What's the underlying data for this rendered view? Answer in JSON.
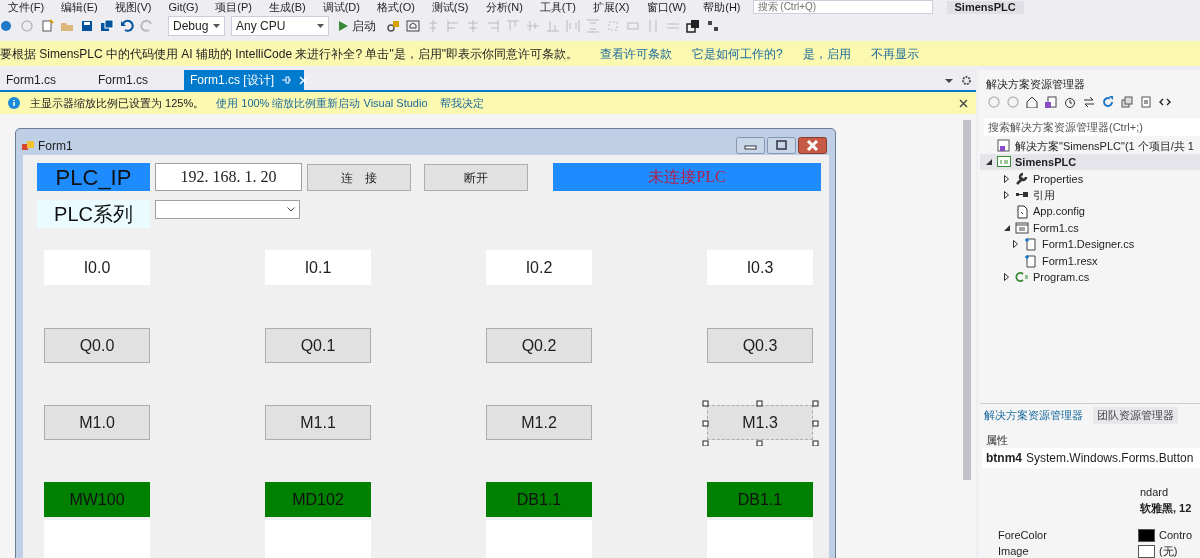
{
  "menu": [
    "文件(F)",
    "编辑(E)",
    "视图(V)",
    "Git(G)",
    "项目(P)",
    "生成(B)",
    "调试(D)",
    "格式(O)",
    "测试(S)",
    "分析(N)",
    "工具(T)",
    "扩展(X)",
    "窗口(W)",
    "帮助(H)"
  ],
  "search": {
    "placeholder": "搜索 (Ctrl+Q)"
  },
  "solution_name": "SimensPLC",
  "toolbar": {
    "configuration": "Debug",
    "platform": "Any CPU",
    "start": "启动"
  },
  "intellicode_bar": {
    "message": "要根据 SimensPLC 中的代码使用 AI 辅助的 IntelliCode 来进行补全? 单击\"是，启用\"即表示你同意许可条款。",
    "links": [
      "查看许可条款",
      "它是如何工作的?",
      "是，启用",
      "不再显示"
    ]
  },
  "tabs": [
    {
      "label": "Form1.cs",
      "selected": false
    },
    {
      "label": "Form1.cs",
      "selected": false
    },
    {
      "label": "Form1.cs [设计]",
      "selected": true
    }
  ],
  "info_bar": {
    "message": "主显示器缩放比例已设置为 125%。",
    "links": [
      "使用 100% 缩放比例重新启动 Visual Studio",
      "帮我决定"
    ]
  },
  "form": {
    "title": "Form1",
    "ip_label": "PLC_IP",
    "ip_value": "192. 168. 1. 20",
    "connect": "连　接",
    "disconnect": "断开",
    "status": "未连接PLC",
    "series_label": "PLC系列",
    "grid": [
      [
        {
          "kind": "label",
          "text": "I0.0",
          "selected": false
        },
        {
          "kind": "label",
          "text": "I0.1",
          "selected": false
        },
        {
          "kind": "label",
          "text": "I0.2",
          "selected": false
        },
        {
          "kind": "label",
          "text": "I0.3",
          "selected": false
        }
      ],
      [
        {
          "kind": "button",
          "text": "Q0.0",
          "selected": false
        },
        {
          "kind": "button",
          "text": "Q0.1",
          "selected": false
        },
        {
          "kind": "button",
          "text": "Q0.2",
          "selected": false
        },
        {
          "kind": "button",
          "text": "Q0.3",
          "selected": false
        }
      ],
      [
        {
          "kind": "button",
          "text": "M1.0",
          "selected": false
        },
        {
          "kind": "button",
          "text": "M1.1",
          "selected": false
        },
        {
          "kind": "button",
          "text": "M1.2",
          "selected": false
        },
        {
          "kind": "button",
          "text": "M1.3",
          "selected": true
        }
      ],
      [
        {
          "kind": "green",
          "text": "MW100",
          "selected": false
        },
        {
          "kind": "green",
          "text": "MD102",
          "selected": false
        },
        {
          "kind": "green",
          "text": "DB1.1",
          "selected": false
        },
        {
          "kind": "green",
          "text": "DB1.1",
          "selected": false
        }
      ]
    ]
  },
  "solution_explorer": {
    "title": "解决方案资源管理器",
    "search": {
      "placeholder": "搜索解决方案资源管理器(Ctrl+;)"
    },
    "tree": [
      {
        "kind": "solution",
        "label": "解决方案\"SimensPLC\"(1 个项目/共 1",
        "children": [
          {
            "kind": "project",
            "label": "SimensPLC",
            "expanded": true,
            "children": [
              {
                "kind": "properties",
                "label": "Properties",
                "expanded": false
              },
              {
                "kind": "references",
                "label": "引用",
                "expanded": false
              },
              {
                "kind": "config",
                "label": "App.config"
              },
              {
                "kind": "form",
                "label": "Form1.cs",
                "expanded": true,
                "children": [
                  {
                    "kind": "file",
                    "label": "Form1.Designer.cs",
                    "expanded": false
                  },
                  {
                    "kind": "file",
                    "label": "Form1.resx"
                  }
                ]
              },
              {
                "kind": "csharp",
                "label": "Program.cs",
                "expanded": false
              }
            ]
          }
        ]
      }
    ]
  },
  "bottom_tabs": [
    {
      "label": "解决方案资源管理器",
      "selected": true
    },
    {
      "label": "团队资源管理器",
      "selected": false
    }
  ],
  "properties": {
    "title": "属性",
    "object": "btnm4",
    "type": "System.Windows.Forms.Button",
    "rows": [
      {
        "value": "ndard",
        "modified": false
      },
      {
        "value": "软雅黑, 12",
        "modified": true
      },
      {
        "name": "ForeColor",
        "value": "Contro",
        "color": "#000000",
        "modified": false
      },
      {
        "name": "Image",
        "value": "(无)",
        "color": "#ffffff",
        "modified": false
      }
    ]
  }
}
